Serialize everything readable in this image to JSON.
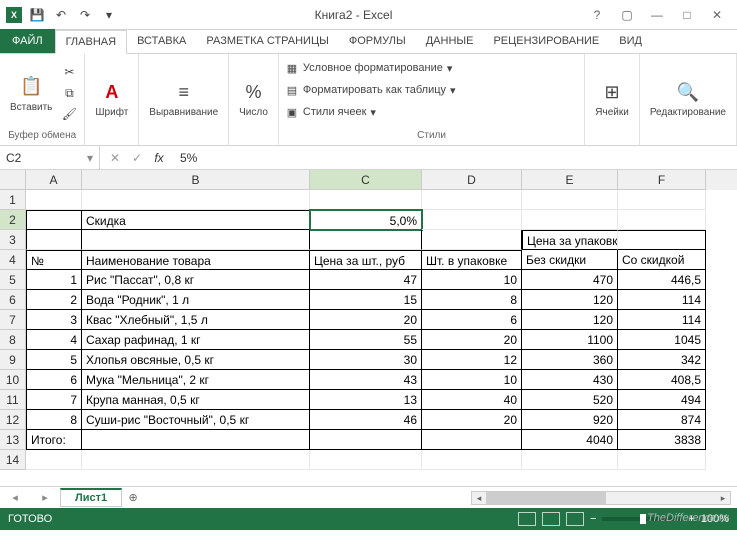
{
  "app": {
    "title": "Книга2 - Excel"
  },
  "qat": {
    "save": "💾",
    "undo": "↶",
    "redo": "↷"
  },
  "win": {
    "help": "?",
    "ribbonToggle": "▢",
    "min": "—",
    "max": "□",
    "close": "✕"
  },
  "tabs": {
    "file": "ФАЙЛ",
    "list": [
      "ГЛАВНАЯ",
      "ВСТАВКА",
      "РАЗМЕТКА СТРАНИЦЫ",
      "ФОРМУЛЫ",
      "ДАННЫЕ",
      "РЕЦЕНЗИРОВАНИЕ",
      "ВИД"
    ]
  },
  "ribbon": {
    "clipboard": {
      "paste": "Вставить",
      "label": "Буфер обмена"
    },
    "font": {
      "btn": "Шрифт"
    },
    "align": {
      "btn": "Выравнивание"
    },
    "number": {
      "btn": "Число",
      "icon": "%"
    },
    "styles": {
      "cond": "Условное форматирование",
      "table": "Форматировать как таблицу",
      "cell": "Стили ячеек",
      "label": "Стили"
    },
    "cells": {
      "btn": "Ячейки"
    },
    "editing": {
      "btn": "Редактирование"
    }
  },
  "nameBox": "C2",
  "formula": "5%",
  "cols": [
    "A",
    "B",
    "C",
    "D",
    "E",
    "F"
  ],
  "sheet": {
    "r2": {
      "b": "Скидка",
      "c": "5,0%"
    },
    "r3": {
      "e_f": "Цена за упаковку, руб"
    },
    "r4": {
      "a": "№",
      "b": "Наименование товара",
      "c": "Цена за шт., руб",
      "d": "Шт. в упаковке",
      "e": "Без скидки",
      "f": "Со скидкой"
    },
    "rows": [
      {
        "a": "1",
        "b": "Рис \"Пассат\", 0,8 кг",
        "c": "47",
        "d": "10",
        "e": "470",
        "f": "446,5"
      },
      {
        "a": "2",
        "b": "Вода \"Родник\", 1 л",
        "c": "15",
        "d": "8",
        "e": "120",
        "f": "114"
      },
      {
        "a": "3",
        "b": "Квас \"Хлебный\", 1,5 л",
        "c": "20",
        "d": "6",
        "e": "120",
        "f": "114"
      },
      {
        "a": "4",
        "b": "Сахар рафинад, 1 кг",
        "c": "55",
        "d": "20",
        "e": "1100",
        "f": "1045"
      },
      {
        "a": "5",
        "b": "Хлопья овсяные, 0,5 кг",
        "c": "30",
        "d": "12",
        "e": "360",
        "f": "342"
      },
      {
        "a": "6",
        "b": "Мука \"Мельница\", 2 кг",
        "c": "43",
        "d": "10",
        "e": "430",
        "f": "408,5"
      },
      {
        "a": "7",
        "b": "Крупа манная, 0,5 кг",
        "c": "13",
        "d": "40",
        "e": "520",
        "f": "494"
      },
      {
        "a": "8",
        "b": "Суши-рис \"Восточный\", 0,5 кг",
        "c": "46",
        "d": "20",
        "e": "920",
        "f": "874"
      }
    ],
    "total": {
      "a": "Итого:",
      "e": "4040",
      "f": "3838"
    }
  },
  "sheetTab": "Лист1",
  "status": {
    "ready": "ГОТОВО",
    "zoom": "100%"
  },
  "watermark": "TheDifference.ru"
}
